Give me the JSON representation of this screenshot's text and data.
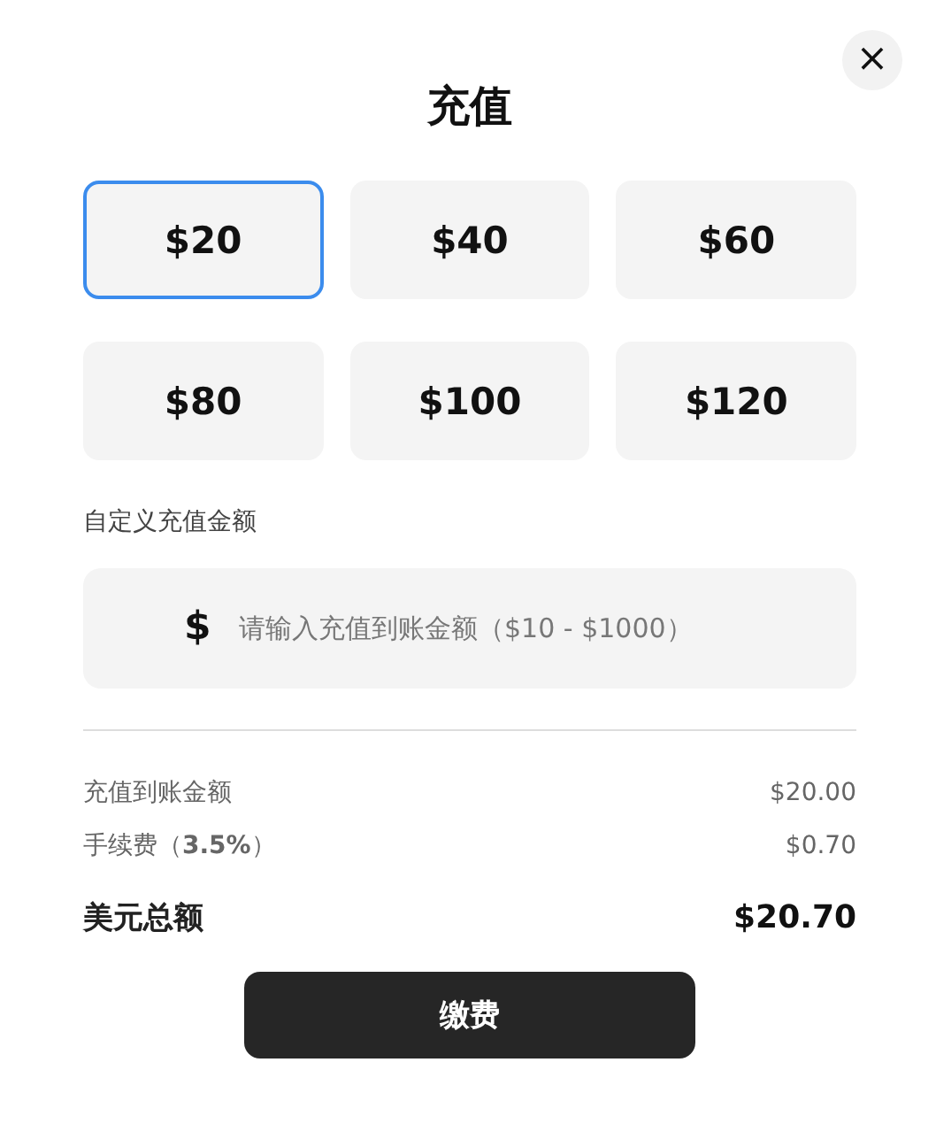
{
  "close_button": {
    "label": "×"
  },
  "title": "充值",
  "amounts": [
    {
      "label": "$20",
      "selected": true
    },
    {
      "label": "$40",
      "selected": false
    },
    {
      "label": "$60",
      "selected": false
    },
    {
      "label": "$80",
      "selected": false
    },
    {
      "label": "$100",
      "selected": false
    },
    {
      "label": "$120",
      "selected": false
    }
  ],
  "custom": {
    "label": "自定义充值金额",
    "currency": "$",
    "placeholder": "请输入充值到账金额（$10 - $1000）"
  },
  "summary": [
    {
      "label": "充值到账金额",
      "value": "$20.00"
    },
    {
      "label": "手续费（**3.5%**）",
      "value": "$0.70"
    }
  ],
  "total": {
    "label": "美元总额",
    "value": "$20.70"
  },
  "pay_button": "缴费"
}
